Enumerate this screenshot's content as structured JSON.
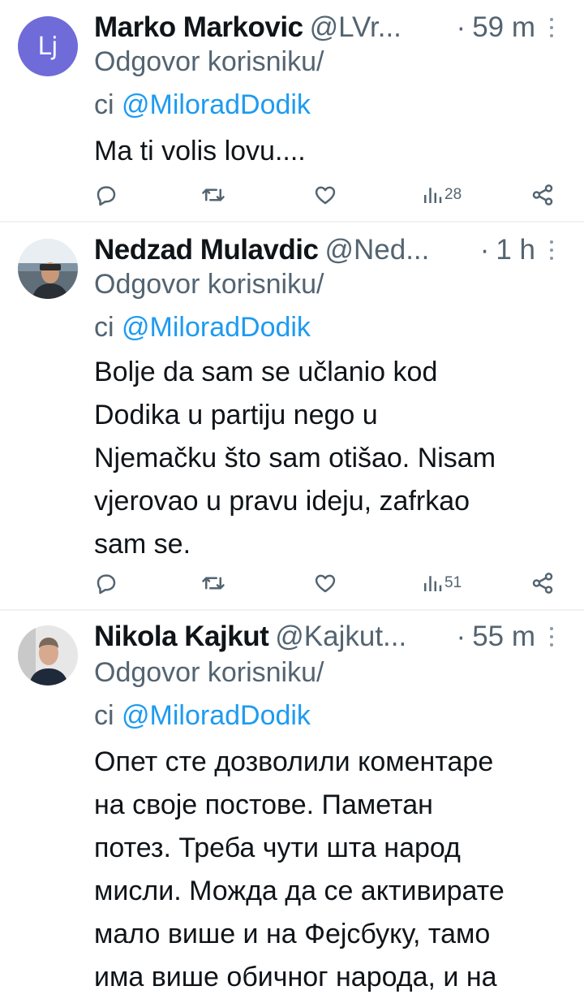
{
  "tweets": [
    {
      "avatar_letters": "Lj",
      "name": "Marko Markovic",
      "handle": "@LVr...",
      "dot": "·",
      "time": "59 m",
      "reply_prefix": "Odgovor korisniku/",
      "reply_ci": "ci",
      "mention": "@MiloradDodik",
      "text_lines": [
        "Ma ti volis lovu...."
      ],
      "views": "28",
      "icons": [
        "reply-icon",
        "retweet-icon",
        "like-icon",
        "views-icon",
        "share-icon",
        "more-icon"
      ]
    },
    {
      "name": "Nedzad Mulavdic",
      "handle": "@Ned...",
      "dot": "·",
      "time": "1 h",
      "reply_prefix": "Odgovor korisniku/",
      "reply_ci": "ci",
      "mention": "@MiloradDodik",
      "text_lines": [
        "Bolje da sam se učlanio kod",
        "Dodika u partiju nego u",
        "Njemačku što sam otišao. Nisam",
        "vjerovao u pravu ideju, zafrkao",
        "sam se."
      ],
      "views": "51"
    },
    {
      "name": "Nikola Kajkut",
      "handle": "@Kajkut...",
      "dot": "·",
      "time": "55 m",
      "reply_prefix": "Odgovor korisniku/",
      "reply_ci": "ci",
      "mention": "@MiloradDodik",
      "text_lines": [
        "Опет сте дозволили коментаре",
        "на своје постове. Паметан",
        "потез. Треба чути шта народ",
        "мисли. Можда да се активирате",
        "мало више и на Фејсбуку, тамо",
        "има више обичног народа, и на"
      ]
    }
  ],
  "colors": {
    "accent": "#1d9bf0",
    "muted": "#536471",
    "text": "#0f1419",
    "avatar_bg": "#6f6bd9"
  }
}
